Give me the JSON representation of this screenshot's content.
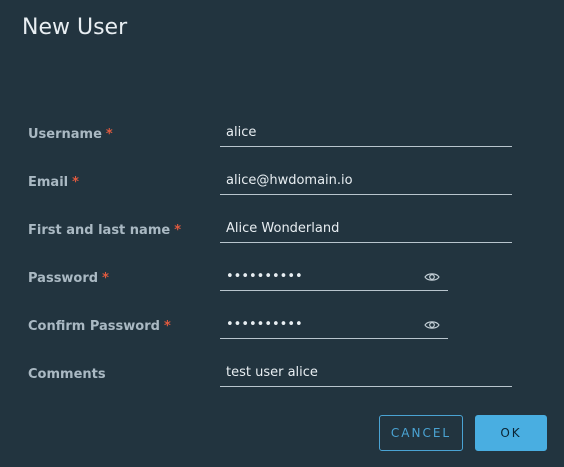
{
  "dialog": {
    "title": "New User"
  },
  "form": {
    "username": {
      "label": "Username",
      "required_mark": "*",
      "value": "alice"
    },
    "email": {
      "label": "Email",
      "required_mark": "*",
      "value": "alice@hwdomain.io"
    },
    "full_name": {
      "label": "First and last name",
      "required_mark": "*",
      "value": "Alice Wonderland"
    },
    "password": {
      "label": "Password",
      "required_mark": "*",
      "value": "••••••••••",
      "toggle_icon": "eye-icon"
    },
    "confirm_password": {
      "label": "Confirm Password",
      "required_mark": "*",
      "value": "••••••••••",
      "toggle_icon": "eye-icon"
    },
    "comments": {
      "label": "Comments",
      "value": "test user alice"
    }
  },
  "actions": {
    "cancel_label": "CANCEL",
    "ok_label": "OK"
  },
  "colors": {
    "background": "#22343f",
    "accent": "#49aee1",
    "required": "#e05a3f",
    "label": "#aab9c3",
    "text": "#e8eef2"
  }
}
